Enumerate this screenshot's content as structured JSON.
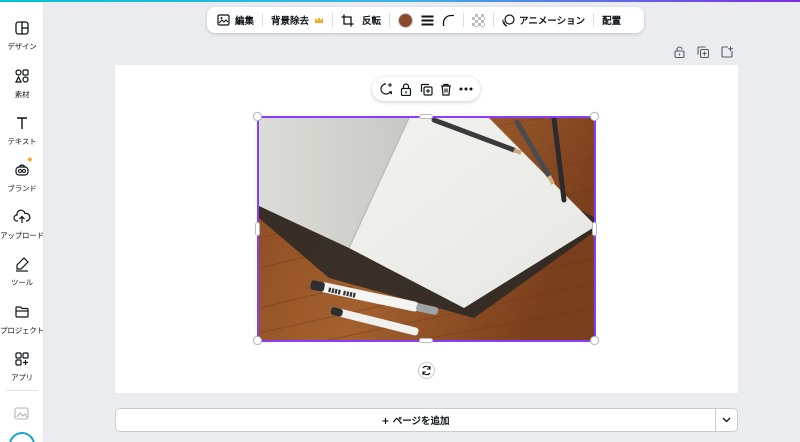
{
  "sidebar": {
    "items": [
      {
        "label": "デザイン",
        "icon": "design-icon"
      },
      {
        "label": "素材",
        "icon": "elements-icon"
      },
      {
        "label": "テキスト",
        "icon": "text-icon"
      },
      {
        "label": "ブランド",
        "icon": "brand-icon"
      },
      {
        "label": "アップロード",
        "icon": "upload-icon"
      },
      {
        "label": "ツール",
        "icon": "tools-icon"
      },
      {
        "label": "プロジェクト",
        "icon": "folder-icon"
      },
      {
        "label": "アプリ",
        "icon": "apps-icon"
      }
    ]
  },
  "toolbar": {
    "edit_label": "編集",
    "bg_remove_label": "背景除去",
    "flip_label": "反転",
    "animation_label": "アニメーション",
    "position_label": "配置",
    "fill_color": "#8b4a2b"
  },
  "add_page": {
    "label": "+ ページを追加"
  },
  "colors": {
    "accent": "#8b3dff",
    "premium": "#f5a623"
  }
}
